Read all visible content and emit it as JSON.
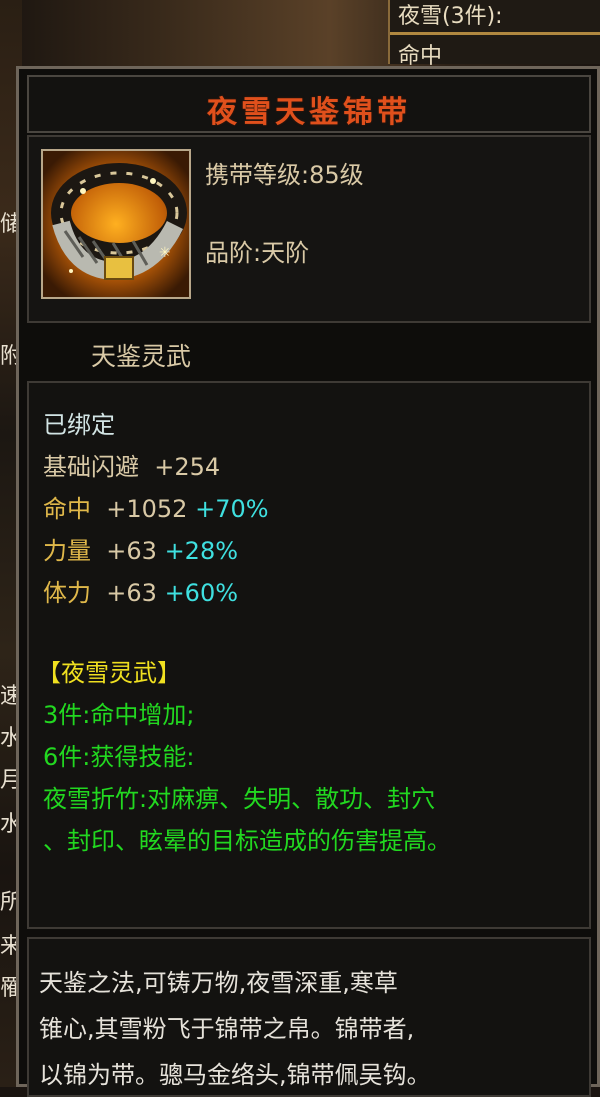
{
  "side_panel": {
    "title": "夜雪(3件):",
    "subtitle": "命中"
  },
  "left_glyphs": [
    "储",
    "附",
    "速",
    "水",
    "月",
    "水",
    "所",
    "来",
    "罹"
  ],
  "item": {
    "name": "夜雪天鉴锦带",
    "icon": "belt-icon",
    "level_label": "携带等级:",
    "level_value": "85级",
    "grade_label": "品阶:",
    "grade_value": "天阶",
    "set_name": "天鉴灵武"
  },
  "attributes": {
    "bound": "已绑定",
    "base": {
      "label": "基础闪避",
      "value": "+254"
    },
    "stats": [
      {
        "label": "命中",
        "value": "+1052",
        "bonus": "+70%"
      },
      {
        "label": "力量",
        "value": "+63",
        "bonus": "+28%"
      },
      {
        "label": "体力",
        "value": "+63",
        "bonus": "+60%"
      }
    ]
  },
  "set_bonus": {
    "title": "【夜雪灵武】",
    "piece3": "3件:命中增加;",
    "piece6": "6件:获得技能:",
    "skill_line1": "夜雪折竹:对麻痹、失明、散功、封穴",
    "skill_line2": "、封印、眩晕的目标造成的伤害提高。"
  },
  "description": [
    "天鉴之法,可铸万物,夜雪深重,寒草",
    "锥心,其雪粉飞于锦带之帛。锦带者,",
    "以锦为带。骢马金络头,锦带佩吴钩。"
  ],
  "colors": {
    "title": "#e0501c",
    "bound": "#d2e4e4",
    "gold": "#e0b84a",
    "bonus": "#3fe0e0",
    "set_title": "#f0e020",
    "set_text": "#22d820"
  }
}
